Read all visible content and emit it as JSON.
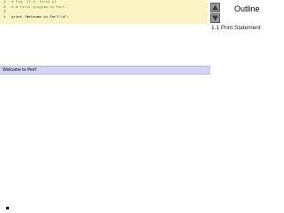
{
  "code": {
    "lines": [
      {
        "number": "1",
        "text": "# Fig. 27.4: first.pl",
        "kind": "comment"
      },
      {
        "number": "2",
        "text": "# A first program in Perl.",
        "kind": "comment"
      },
      {
        "number": "3",
        "text": "",
        "kind": "code"
      },
      {
        "number": "4",
        "text": "print \"Welcome to Perl!\\n\";",
        "kind": "code"
      }
    ]
  },
  "output": {
    "text": "Welcome to Perl!"
  },
  "outline": {
    "title": "Outline",
    "items": [
      {
        "label": "1.1 Print Statement"
      }
    ]
  },
  "nav": {
    "up_icon": "arrow-up-icon",
    "down_icon": "arrow-down-icon"
  },
  "colors": {
    "code_background": "#fcf3c4",
    "comment": "#3d8a2d",
    "output_background": "#d3d3f2",
    "nav_button": "#9a9a9a"
  }
}
